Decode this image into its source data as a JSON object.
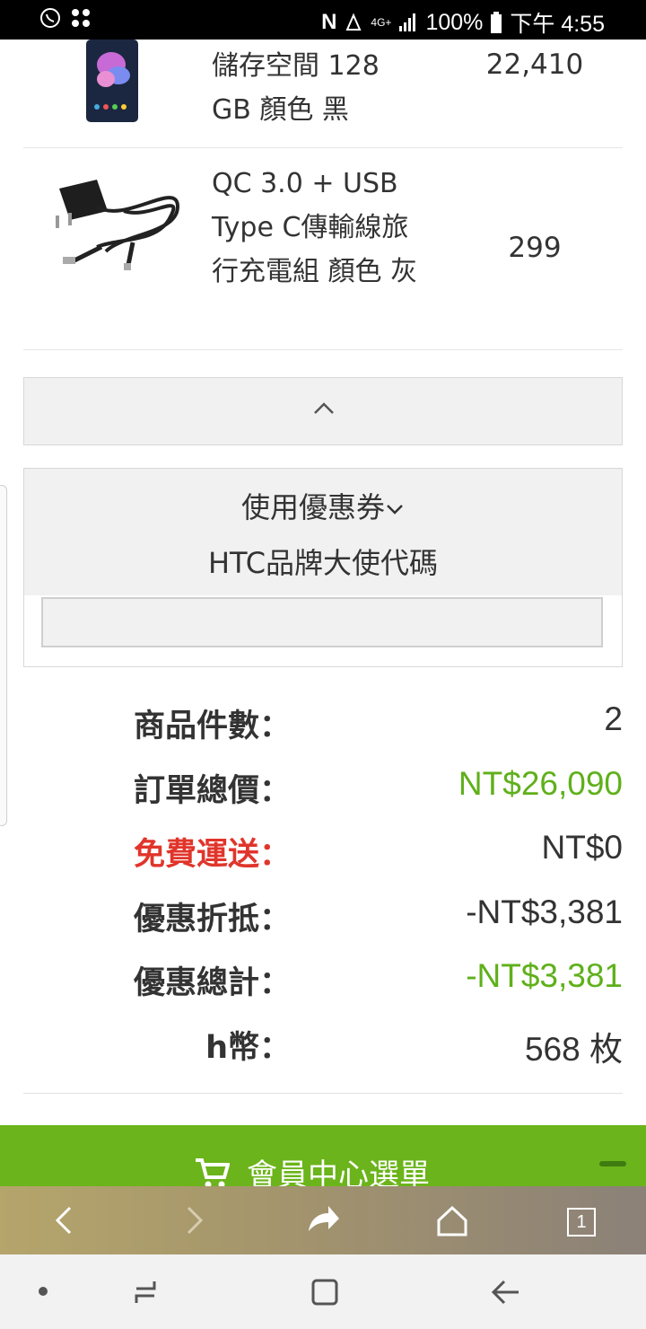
{
  "status_bar": {
    "battery": "100%",
    "time": "下午 4:55",
    "network": "4G+"
  },
  "products": [
    {
      "name": "儲存空間 128 GB 顏色 黑",
      "price": "22,410",
      "image": "smartphone-image"
    },
    {
      "name": "QC 3.0 + USB Type C傳輸線旅行充電組 顏色 灰",
      "price": "299",
      "image": "charger-image"
    }
  ],
  "coupon": {
    "toggle_label": "使用優惠券",
    "code_label": "HTC品牌大使代碼",
    "input_value": ""
  },
  "summary": [
    {
      "label": "商品件數：",
      "value": "2",
      "style": "normal"
    },
    {
      "label": "訂單總價：",
      "value": "NT$26,090",
      "style": "green"
    },
    {
      "label": "免費運送：",
      "value": "NT$0",
      "style": "red-label"
    },
    {
      "label": "優惠折抵：",
      "value": "-NT$3,381",
      "style": "normal"
    },
    {
      "label": "優惠總計：",
      "value": "-NT$3,381",
      "style": "green"
    },
    {
      "label": "h幣：",
      "value": "568 枚",
      "style": "normal"
    }
  ],
  "member_bar": {
    "label": "會員中心選單"
  },
  "browser_toolbar": {
    "tabs_count": "1"
  },
  "colors": {
    "accent_green": "#6bb41b",
    "price_green": "#5fb01a",
    "alert_red": "#e0352b"
  }
}
